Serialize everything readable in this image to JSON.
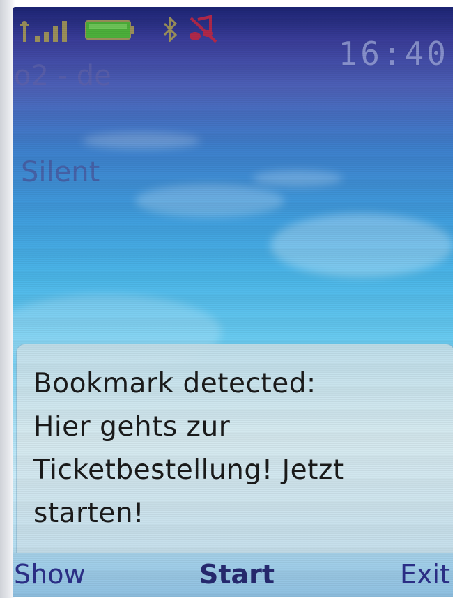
{
  "status": {
    "signal_icon": "signal-strength-icon",
    "battery_icon": "battery-icon",
    "bluetooth_icon": "bluetooth-icon",
    "silent_icon": "silent-profile-icon",
    "time": "16:40"
  },
  "idle": {
    "operator": "o2 - de",
    "profile": "Silent"
  },
  "notification": {
    "lines": [
      "Bookmark detected:",
      "Hier gehts zur",
      "Ticketbestellung! Jetzt",
      "starten!"
    ]
  },
  "softkeys": {
    "left": "Show",
    "center": "Start",
    "right": "Exit"
  },
  "colors": {
    "softkey_text": "#2c2f88",
    "status_icons": "#9a8f5a",
    "battery_fill": "#4caf3a",
    "silent_icon": "#b0284a"
  }
}
